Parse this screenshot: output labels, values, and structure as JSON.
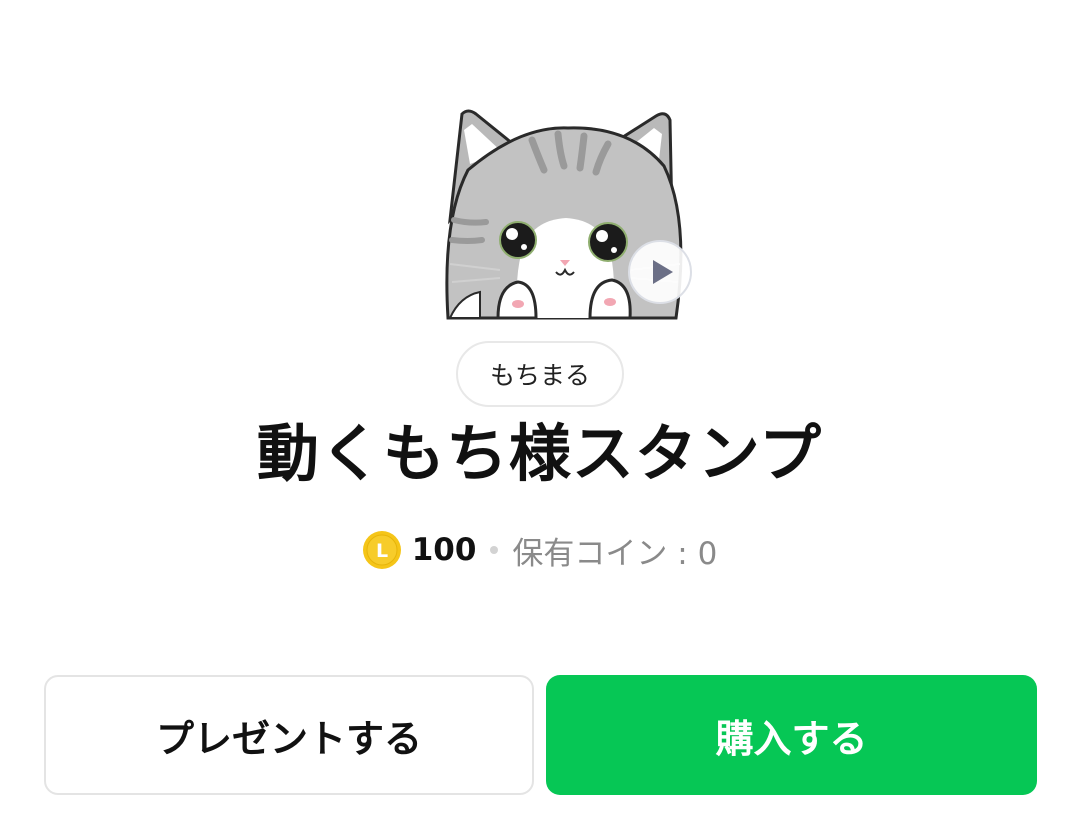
{
  "sticker": {
    "preview_image": "cat-sticker-preview",
    "play_icon": "play-icon"
  },
  "author": {
    "name": "もちまる"
  },
  "title": "動くもち様スタンプ",
  "price": {
    "coin_icon": "line-coin-icon",
    "coin_letter": "L",
    "amount": "100",
    "owned_coins": "保有コイン : 0"
  },
  "actions": {
    "present_label": "プレゼントする",
    "buy_label": "購入する"
  },
  "colors": {
    "buy_button": "#06c755",
    "coin": "#f5c518",
    "owned_text": "#8a8a8a"
  }
}
